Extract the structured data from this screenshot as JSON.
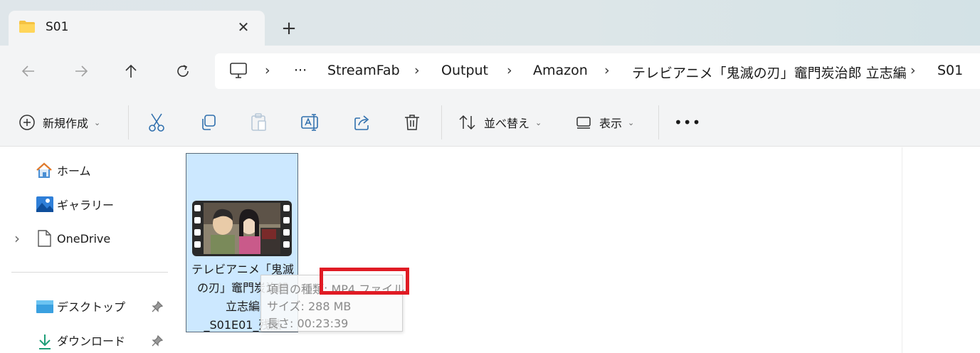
{
  "tab": {
    "title": "S01",
    "close_glyph": "✕",
    "new_tab_glyph": "+"
  },
  "nav": {
    "back_icon": "arrow-left-icon",
    "forward_icon": "arrow-right-icon",
    "up_icon": "arrow-up-icon",
    "refresh_icon": "refresh-icon"
  },
  "breadcrumb": {
    "separator": "›",
    "more": "···",
    "items": [
      "StreamFab",
      "Output",
      "Amazon",
      "テレビアニメ「鬼滅の刃」竈門炭治郎 立志編",
      "S01"
    ]
  },
  "commands": {
    "new": "新規作成",
    "sort": "並べ替え",
    "view": "表示",
    "more": "•••"
  },
  "sidebar": {
    "home": "ホーム",
    "gallery": "ギャラリー",
    "onedrive": "OneDrive",
    "desktop": "デスクトップ",
    "downloads": "ダウンロード",
    "expand_glyph": "›",
    "pin_glyph": "📌"
  },
  "file": {
    "name_line1": "テレビアニメ「鬼滅",
    "name_line2": "の刃」竈門炭治郎",
    "name_line3": "立志編",
    "name_line4": "_S01E01_残酷"
  },
  "tooltip": {
    "type": "項目の種類: MP4 ファイル",
    "size": "サイズ: 288 MB",
    "length": "長さ: 00:23:39"
  },
  "colors": {
    "selection": "#cce8ff",
    "highlight": "#e01b24",
    "folder": "#f5c242"
  }
}
